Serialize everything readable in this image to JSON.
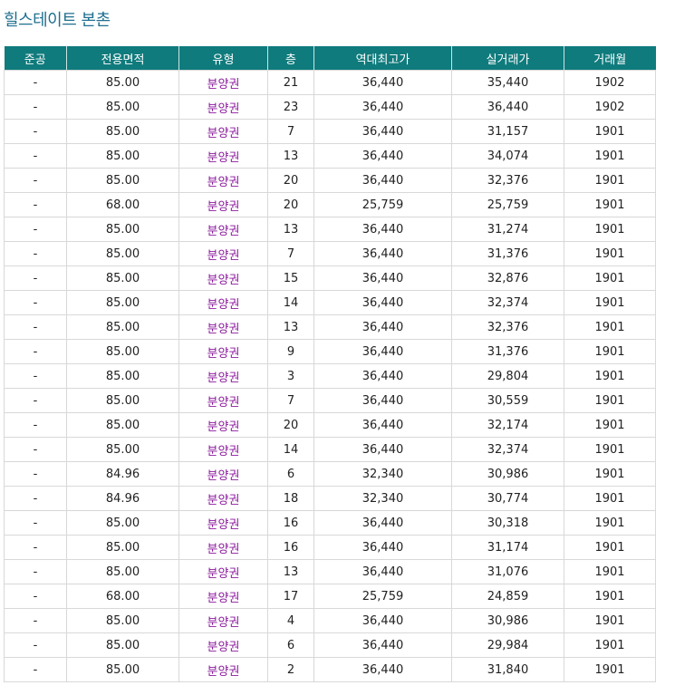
{
  "title": "힐스테이트 본촌",
  "columns": [
    "준공",
    "전용면적",
    "유형",
    "층",
    "역대최고가",
    "실거래가",
    "거래월"
  ],
  "rows": [
    [
      "-",
      "85.00",
      "분양권",
      "21",
      "36,440",
      "35,440",
      "1902"
    ],
    [
      "-",
      "85.00",
      "분양권",
      "23",
      "36,440",
      "36,440",
      "1902"
    ],
    [
      "-",
      "85.00",
      "분양권",
      "7",
      "36,440",
      "31,157",
      "1901"
    ],
    [
      "-",
      "85.00",
      "분양권",
      "13",
      "36,440",
      "34,074",
      "1901"
    ],
    [
      "-",
      "85.00",
      "분양권",
      "20",
      "36,440",
      "32,376",
      "1901"
    ],
    [
      "-",
      "68.00",
      "분양권",
      "20",
      "25,759",
      "25,759",
      "1901"
    ],
    [
      "-",
      "85.00",
      "분양권",
      "13",
      "36,440",
      "31,274",
      "1901"
    ],
    [
      "-",
      "85.00",
      "분양권",
      "7",
      "36,440",
      "31,376",
      "1901"
    ],
    [
      "-",
      "85.00",
      "분양권",
      "15",
      "36,440",
      "32,876",
      "1901"
    ],
    [
      "-",
      "85.00",
      "분양권",
      "14",
      "36,440",
      "32,374",
      "1901"
    ],
    [
      "-",
      "85.00",
      "분양권",
      "13",
      "36,440",
      "32,376",
      "1901"
    ],
    [
      "-",
      "85.00",
      "분양권",
      "9",
      "36,440",
      "31,376",
      "1901"
    ],
    [
      "-",
      "85.00",
      "분양권",
      "3",
      "36,440",
      "29,804",
      "1901"
    ],
    [
      "-",
      "85.00",
      "분양권",
      "7",
      "36,440",
      "30,559",
      "1901"
    ],
    [
      "-",
      "85.00",
      "분양권",
      "20",
      "36,440",
      "32,174",
      "1901"
    ],
    [
      "-",
      "85.00",
      "분양권",
      "14",
      "36,440",
      "32,374",
      "1901"
    ],
    [
      "-",
      "84.96",
      "분양권",
      "6",
      "32,340",
      "30,986",
      "1901"
    ],
    [
      "-",
      "84.96",
      "분양권",
      "18",
      "32,340",
      "30,774",
      "1901"
    ],
    [
      "-",
      "85.00",
      "분양권",
      "16",
      "36,440",
      "30,318",
      "1901"
    ],
    [
      "-",
      "85.00",
      "분양권",
      "16",
      "36,440",
      "31,174",
      "1901"
    ],
    [
      "-",
      "85.00",
      "분양권",
      "13",
      "36,440",
      "31,076",
      "1901"
    ],
    [
      "-",
      "68.00",
      "분양권",
      "17",
      "25,759",
      "24,859",
      "1901"
    ],
    [
      "-",
      "85.00",
      "분양권",
      "4",
      "36,440",
      "30,986",
      "1901"
    ],
    [
      "-",
      "85.00",
      "분양권",
      "6",
      "36,440",
      "29,984",
      "1901"
    ],
    [
      "-",
      "85.00",
      "분양권",
      "2",
      "36,440",
      "31,840",
      "1901"
    ]
  ],
  "colors": {
    "title": "#1f6f8f",
    "header_bg": "#0f7b7d",
    "header_text": "#ffffff",
    "type_text": "#8b1a9c",
    "border": "#d8d8d8"
  }
}
